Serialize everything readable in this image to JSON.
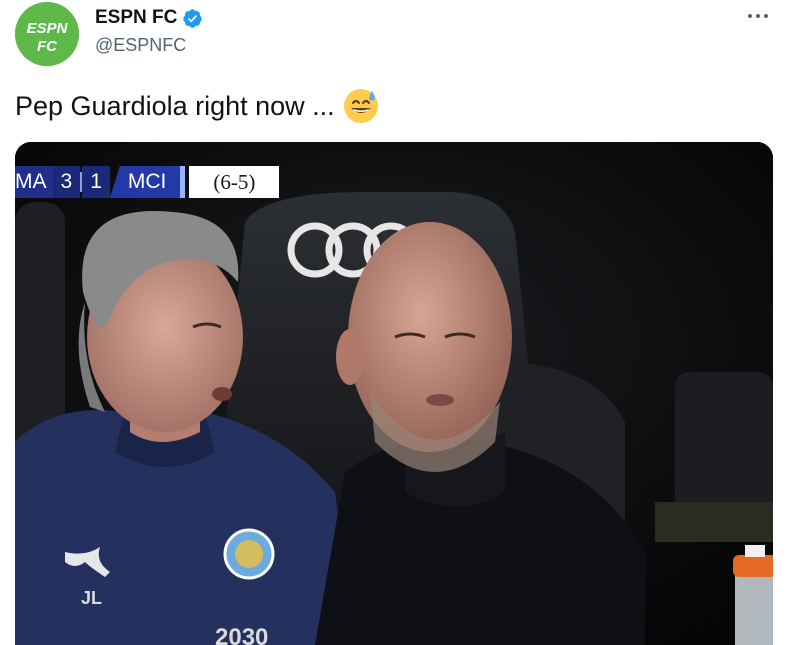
{
  "author": {
    "display_name": "ESPN FC",
    "handle": "@ESPNFC",
    "avatar_text_top": "ESPN",
    "avatar_text_bottom": "FC",
    "avatar_color": "#5fb84a",
    "verified": true
  },
  "tweet": {
    "text": "Pep Guardiola right now ...",
    "emoji": "grinning-sweat-emoji"
  },
  "scorebug": {
    "home_team": "MA",
    "home_score": "3",
    "away_score": "1",
    "away_team": "MCI",
    "aggregate": "(6-5)"
  },
  "image_text": {
    "crest_initials": "JL",
    "shirt_text": "2030"
  },
  "colors": {
    "brand_green": "#5fb84a",
    "verified_blue": "#1d9bf0",
    "scorebug_blue": "#2438a8"
  }
}
